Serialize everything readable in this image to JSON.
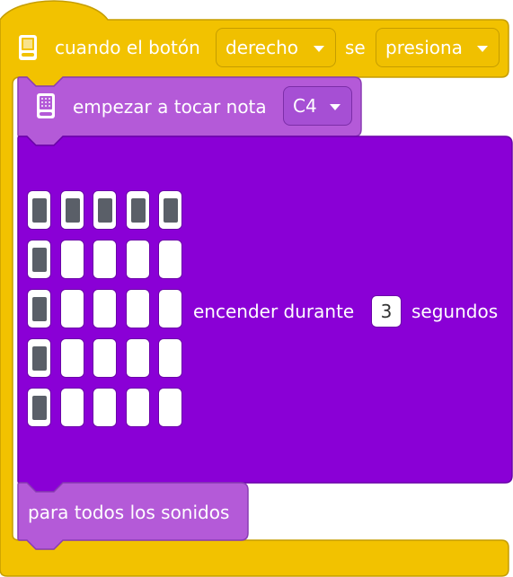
{
  "hat_block": {
    "label": "cuando el botón",
    "button_dropdown": "derecho",
    "middle_label": "se",
    "action_dropdown": "presiona",
    "color": "#f2c200"
  },
  "note_block": {
    "label": "empezar a tocar nota",
    "note_dropdown": "C4",
    "color": "#b45ad8"
  },
  "display_block": {
    "label_before": "encender durante",
    "seconds": "3",
    "label_after": "segundos",
    "color": "#8a00d6",
    "led_matrix": [
      [
        1,
        1,
        1,
        1,
        1
      ],
      [
        1,
        0,
        0,
        0,
        0
      ],
      [
        1,
        0,
        0,
        0,
        0
      ],
      [
        1,
        0,
        0,
        0,
        0
      ],
      [
        1,
        0,
        0,
        0,
        0
      ]
    ]
  },
  "stop_block": {
    "label": "para todos los sonidos",
    "color": "#b45ad8"
  },
  "icons": [
    "hub-icon",
    "speaker-hub-icon"
  ]
}
